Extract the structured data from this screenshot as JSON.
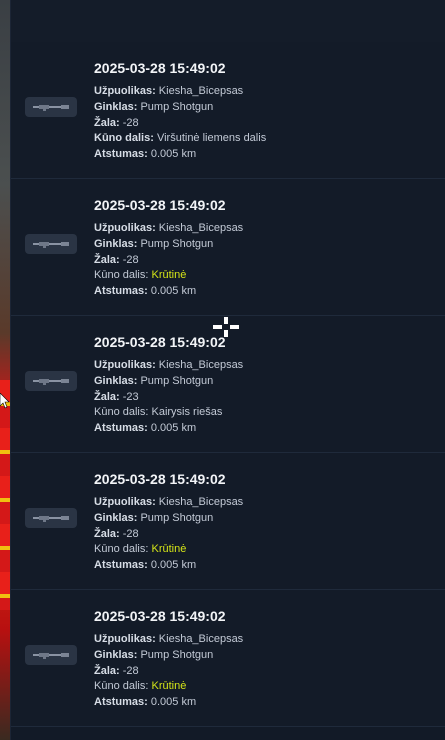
{
  "entries": [
    {
      "time": "2025-03-28 15:49:02",
      "attacker_label": "Užpuolikas:",
      "attacker": "Kiesha_Bicepsas",
      "weapon_label": "Ginklas:",
      "weapon": "Pump Shotgun",
      "damage_label": "Žala:",
      "damage": "-28",
      "bodypart_label": "Kūno dalis:",
      "bodypart": "Viršutinė liemens dalis",
      "bodypart_highlight": false,
      "bodypart_bold": true,
      "distance_label": "Atstumas:",
      "distance": "0.005 km"
    },
    {
      "time": "2025-03-28 15:49:02",
      "attacker_label": "Užpuolikas:",
      "attacker": "Kiesha_Bicepsas",
      "weapon_label": "Ginklas:",
      "weapon": "Pump Shotgun",
      "damage_label": "Žala:",
      "damage": "-28",
      "bodypart_label": "Kūno dalis:",
      "bodypart": "Krūtinė",
      "bodypart_highlight": true,
      "bodypart_bold": false,
      "distance_label": "Atstumas:",
      "distance": "0.005 km"
    },
    {
      "time": "2025-03-28 15:49:02",
      "attacker_label": "Užpuolikas:",
      "attacker": "Kiesha_Bicepsas",
      "weapon_label": "Ginklas:",
      "weapon": "Pump Shotgun",
      "damage_label": "Žala:",
      "damage": "-23",
      "bodypart_label": "Kūno dalis:",
      "bodypart": "Kairysis riešas",
      "bodypart_highlight": false,
      "bodypart_bold": false,
      "distance_label": "Atstumas:",
      "distance": "0.005 km"
    },
    {
      "time": "2025-03-28 15:49:02",
      "attacker_label": "Užpuolikas:",
      "attacker": "Kiesha_Bicepsas",
      "weapon_label": "Ginklas:",
      "weapon": "Pump Shotgun",
      "damage_label": "Žala:",
      "damage": "-28",
      "bodypart_label": "Kūno dalis:",
      "bodypart": "Krūtinė",
      "bodypart_highlight": true,
      "bodypart_bold": false,
      "distance_label": "Atstumas:",
      "distance": "0.005 km"
    },
    {
      "time": "2025-03-28 15:49:02",
      "attacker_label": "Užpuolikas:",
      "attacker": "Kiesha_Bicepsas",
      "weapon_label": "Ginklas:",
      "weapon": "Pump Shotgun",
      "damage_label": "Žala:",
      "damage": "-28",
      "bodypart_label": "Kūno dalis:",
      "bodypart": "Krūtinė",
      "bodypart_highlight": true,
      "bodypart_bold": false,
      "distance_label": "Atstumas:",
      "distance": "0.005 km"
    }
  ],
  "icons": {
    "weapon": "shotgun-icon",
    "cursor": "move-crosshair-icon"
  },
  "colors": {
    "panel_bg": "#121a27",
    "highlight": "#d4e417",
    "text": "#c3cad6",
    "time": "#f2f4f7"
  }
}
